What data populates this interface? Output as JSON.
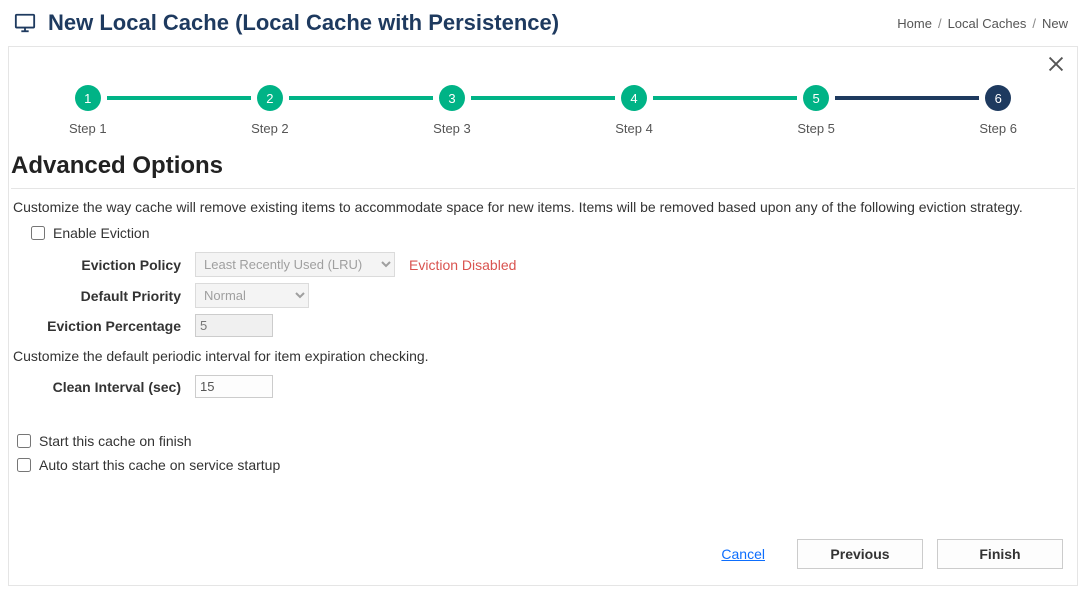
{
  "header": {
    "title": "New Local Cache (Local Cache with Persistence)"
  },
  "breadcrumb": {
    "home": "Home",
    "caches": "Local Caches",
    "new": "New"
  },
  "steps": {
    "s1": {
      "num": "1",
      "label": "Step 1"
    },
    "s2": {
      "num": "2",
      "label": "Step 2"
    },
    "s3": {
      "num": "3",
      "label": "Step 3"
    },
    "s4": {
      "num": "4",
      "label": "Step 4"
    },
    "s5": {
      "num": "5",
      "label": "Step 5"
    },
    "s6": {
      "num": "6",
      "label": "Step 6"
    }
  },
  "section": {
    "title": "Advanced Options",
    "desc_eviction": "Customize the way cache will remove existing items to accommodate space for new items. Items will be removed based upon any of the following eviction strategy.",
    "desc_clean": "Customize the default periodic interval for item expiration checking."
  },
  "form": {
    "enable_eviction_label": "Enable Eviction",
    "eviction_policy_label": "Eviction Policy",
    "eviction_policy_value": "Least Recently Used (LRU)",
    "eviction_disabled_warn": "Eviction Disabled",
    "default_priority_label": "Default Priority",
    "default_priority_value": "Normal",
    "eviction_percentage_label": "Eviction Percentage",
    "eviction_percentage_value": "5",
    "clean_interval_label": "Clean Interval (sec)",
    "clean_interval_value": "15",
    "start_on_finish_label": "Start this cache on finish",
    "auto_start_label": "Auto start this cache on service startup"
  },
  "footer": {
    "cancel": "Cancel",
    "previous": "Previous",
    "finish": "Finish"
  }
}
